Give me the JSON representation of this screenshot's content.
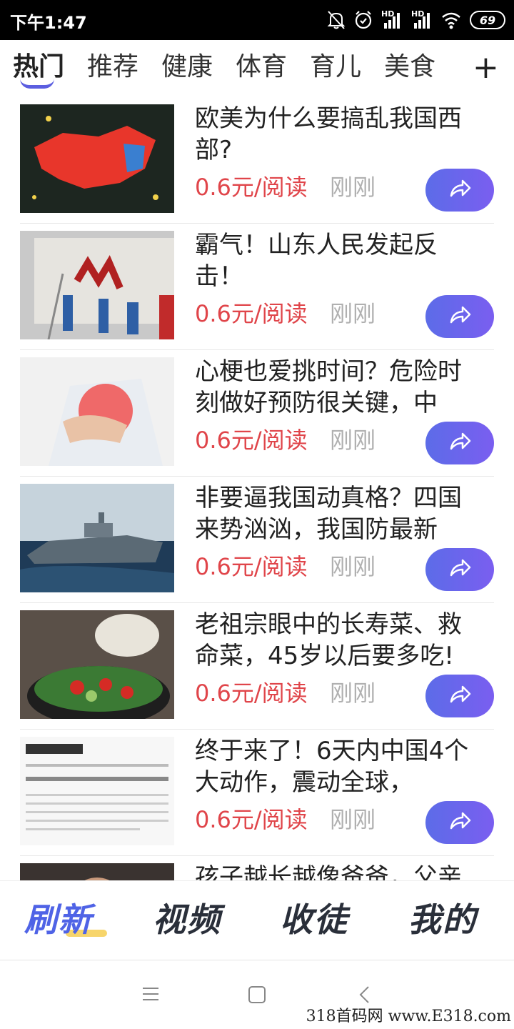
{
  "status_bar": {
    "time": "下午1:47",
    "signal1": "HD",
    "signal2": "HD",
    "battery": "69"
  },
  "tabs": [
    "热门",
    "推荐",
    "健康",
    "体育",
    "育儿",
    "美食"
  ],
  "tabs_add": "+",
  "feed": [
    {
      "title": "欧美为什么要搞乱我国西部?",
      "price": "0.6元/阅读",
      "time": "刚刚"
    },
    {
      "title": "霸气！山东人民发起反击！",
      "price": "0.6元/阅读",
      "time": "刚刚"
    },
    {
      "title": "心梗也爱挑时间？危险时刻做好预防很关键，中老…",
      "price": "0.6元/阅读",
      "time": "刚刚"
    },
    {
      "title": "非要逼我国动真格？四国来势汹汹，我国防最新表…",
      "price": "0.6元/阅读",
      "time": "刚刚"
    },
    {
      "title": "老祖宗眼中的长寿菜、救命菜，45岁以后要多吃!",
      "price": "0.6元/阅读",
      "time": "刚刚"
    },
    {
      "title": "终于来了！6天内中国4个大动作，震动全球，",
      "price": "0.6元/阅读",
      "time": "刚刚"
    },
    {
      "title": "孩子越长越像爸爸，父亲",
      "price": "",
      "time": ""
    }
  ],
  "bottom_nav": [
    "刷新",
    "视频",
    "收徒",
    "我的"
  ],
  "watermark": "318首码网 www.E318.com",
  "colors": {
    "accent": "#5b5ee0",
    "price": "#e0454a",
    "share_start": "#5c6ce8",
    "share_end": "#7a5ef0"
  },
  "icons": [
    "mute-icon",
    "alarm-icon",
    "signal-icon",
    "wifi-icon",
    "battery-icon",
    "share-icon",
    "menu-icon",
    "home-icon",
    "back-icon"
  ]
}
